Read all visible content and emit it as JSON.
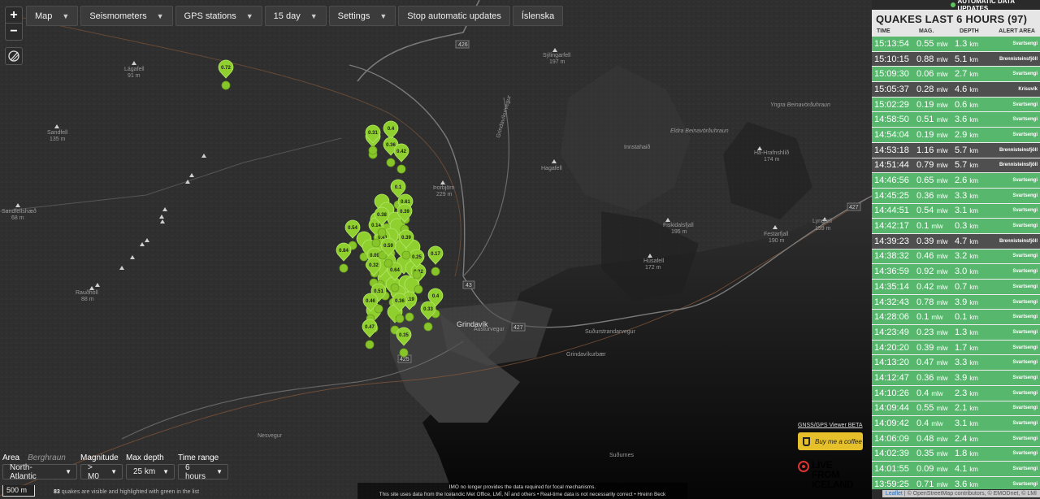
{
  "topbar": {
    "map": "Map",
    "seismometers": "Seismometers",
    "gps": "GPS stations",
    "period": "15 day",
    "settings": "Settings",
    "stop": "Stop automatic updates",
    "lang": "Íslenska"
  },
  "zoom": {
    "in": "+",
    "out": "−"
  },
  "status": "AUTOMATIC DATA UPDATES",
  "quakes": {
    "title": "QUAKES LAST 6 HOURS (97)",
    "headers": [
      "TIME",
      "MAG.",
      "DEPTH",
      "ALERT AREA"
    ],
    "mag_unit": "mlw",
    "depth_unit": "km",
    "rows": [
      {
        "time": "15:13:54",
        "mag": "0.55",
        "depth": "1.3",
        "area": "Svartsengi",
        "color": "green"
      },
      {
        "time": "15:10:15",
        "mag": "0.88",
        "depth": "5.1",
        "area": "Brennisteinsfjöll",
        "color": "gray"
      },
      {
        "time": "15:09:30",
        "mag": "0.06",
        "depth": "2.7",
        "area": "Svartsengi",
        "color": "green"
      },
      {
        "time": "15:05:37",
        "mag": "0.28",
        "depth": "4.6",
        "area": "Krísuvík",
        "color": "gray"
      },
      {
        "time": "15:02:29",
        "mag": "0.19",
        "depth": "0.6",
        "area": "Svartsengi",
        "color": "green"
      },
      {
        "time": "14:58:50",
        "mag": "0.51",
        "depth": "3.6",
        "area": "Svartsengi",
        "color": "green"
      },
      {
        "time": "14:54:04",
        "mag": "0.19",
        "depth": "2.9",
        "area": "Svartsengi",
        "color": "green"
      },
      {
        "time": "14:53:18",
        "mag": "1.16",
        "depth": "5.7",
        "area": "Brennisteinsfjöll",
        "color": "gray"
      },
      {
        "time": "14:51:44",
        "mag": "0.79",
        "depth": "5.7",
        "area": "Brennisteinsfjöll",
        "color": "gray"
      },
      {
        "time": "14:46:56",
        "mag": "0.65",
        "depth": "2.6",
        "area": "Svartsengi",
        "color": "green"
      },
      {
        "time": "14:45:25",
        "mag": "0.36",
        "depth": "3.3",
        "area": "Svartsengi",
        "color": "green"
      },
      {
        "time": "14:44:51",
        "mag": "0.54",
        "depth": "3.1",
        "area": "Svartsengi",
        "color": "green"
      },
      {
        "time": "14:42:17",
        "mag": "0.1",
        "depth": "0.3",
        "area": "Svartsengi",
        "color": "green"
      },
      {
        "time": "14:39:23",
        "mag": "0.39",
        "depth": "4.7",
        "area": "Brennisteinsfjöll",
        "color": "gray"
      },
      {
        "time": "14:38:32",
        "mag": "0.46",
        "depth": "3.2",
        "area": "Svartsengi",
        "color": "green"
      },
      {
        "time": "14:36:59",
        "mag": "0.92",
        "depth": "3.0",
        "area": "Svartsengi",
        "color": "green"
      },
      {
        "time": "14:35:14",
        "mag": "0.42",
        "depth": "0.7",
        "area": "Svartsengi",
        "color": "green"
      },
      {
        "time": "14:32:43",
        "mag": "0.78",
        "depth": "3.9",
        "area": "Svartsengi",
        "color": "green"
      },
      {
        "time": "14:28:06",
        "mag": "0.1",
        "depth": "0.1",
        "area": "Svartsengi",
        "color": "green"
      },
      {
        "time": "14:23:49",
        "mag": "0.23",
        "depth": "1.3",
        "area": "Svartsengi",
        "color": "green"
      },
      {
        "time": "14:20:20",
        "mag": "0.39",
        "depth": "1.7",
        "area": "Svartsengi",
        "color": "green"
      },
      {
        "time": "14:13:20",
        "mag": "0.47",
        "depth": "3.3",
        "area": "Svartsengi",
        "color": "green"
      },
      {
        "time": "14:12:47",
        "mag": "0.36",
        "depth": "3.9",
        "area": "Svartsengi",
        "color": "green"
      },
      {
        "time": "14:10:26",
        "mag": "0.4",
        "depth": "2.3",
        "area": "Svartsengi",
        "color": "green"
      },
      {
        "time": "14:09:44",
        "mag": "0.55",
        "depth": "2.1",
        "area": "Svartsengi",
        "color": "green"
      },
      {
        "time": "14:09:42",
        "mag": "0.4",
        "depth": "3.1",
        "area": "Svartsengi",
        "color": "green"
      },
      {
        "time": "14:06:09",
        "mag": "0.48",
        "depth": "2.4",
        "area": "Svartsengi",
        "color": "green"
      },
      {
        "time": "14:02:39",
        "mag": "0.35",
        "depth": "1.8",
        "area": "Svartsengi",
        "color": "green"
      },
      {
        "time": "14:01:55",
        "mag": "0.09",
        "depth": "4.1",
        "area": "Svartsengi",
        "color": "green"
      },
      {
        "time": "13:59:25",
        "mag": "0.71",
        "depth": "3.6",
        "area": "Svartsengi",
        "color": "green"
      }
    ]
  },
  "colors": {
    "green_row": "#57b86d",
    "gray_row": "#4f4f4f",
    "quake_marker": "#8fd02f",
    "accent_yellow": "#e6c02a"
  },
  "map": {
    "places": [
      {
        "name": "Lágafell",
        "elev": "91 m"
      },
      {
        "name": "Sandfell",
        "elev": "135 m"
      },
      {
        "name": "Sandfellshæð",
        "elev": "68 m"
      },
      {
        "name": "Rauðhóll",
        "elev": "88 m"
      },
      {
        "name": "Þorbjörn",
        "elev": "229 m"
      },
      {
        "name": "Hagafell",
        "elev": ""
      },
      {
        "name": "Sýlingarfell",
        "elev": "197 m"
      },
      {
        "name": "Innstahaið",
        "elev": ""
      },
      {
        "name": "Há-Hrafnshlíð",
        "elev": "174 m"
      },
      {
        "name": "Fiskidalsfjall",
        "elev": "195 m"
      },
      {
        "name": "Húsafell",
        "elev": "172 m"
      },
      {
        "name": "Festarfjall",
        "elev": "190 m"
      },
      {
        "name": "Lyngfell",
        "elev": "159 m"
      },
      {
        "name": "Grindavík",
        "elev": ""
      },
      {
        "name": "Berghraun",
        "elev": ""
      }
    ],
    "roads": [
      "426",
      "43",
      "427",
      "425",
      "427",
      "427",
      "Nesvegur",
      "Suðurstrandarvegur",
      "Grindavíkurvegur",
      "Austurvegur",
      "Suðurnes",
      "Grindavíkurbær"
    ],
    "lava": [
      "Eldra Beinavörðuhraun",
      "Yngra Beinavörðuhraun"
    ],
    "quake_labels": [
      "0.72",
      "0.1",
      "0.31",
      "0.4",
      "0.36",
      "0.42",
      "0.1",
      "0.61",
      "0.39",
      "0.54",
      "0.84",
      "0.09",
      "0.32",
      "0.64",
      "0.17",
      "0.51",
      "0.46",
      "0.19",
      "0.4",
      "0.33",
      "0.47",
      "0.35",
      "0.22",
      "0.36",
      "0.41",
      "0.59",
      "0.25",
      "0.14",
      "0.38",
      "0.39"
    ]
  },
  "filters": {
    "area": {
      "label": "Area",
      "hint": "Berghraun",
      "value": "North-Atlantic"
    },
    "magnitude": {
      "label": "Magnitude",
      "value": "> M0"
    },
    "depth": {
      "label": "Max depth",
      "value": "25 km"
    },
    "range": {
      "label": "Time range",
      "value": "6 hours"
    }
  },
  "scale": "500 m",
  "count_note": {
    "count": "83",
    "text": "quakes are visible and highlighted with green in the list"
  },
  "imo_note": {
    "line1": "IMO no longer provides the data required for focal mechanisms.",
    "line2": "This site uses data from the Icelandic Met Office, LMÍ, NÍ and others • Real-time data is not necessarily correct • Hreinn Beck"
  },
  "gnss_link": "GNSS/GPS Viewer BETA",
  "coffee": "Buy me a coffee",
  "live": "LIVE FROM ICELAND",
  "attribution": {
    "leaflet": "Leaflet",
    "rest": " | © OpenStreetMap contributors, © EMODnet, © LMÍ"
  }
}
